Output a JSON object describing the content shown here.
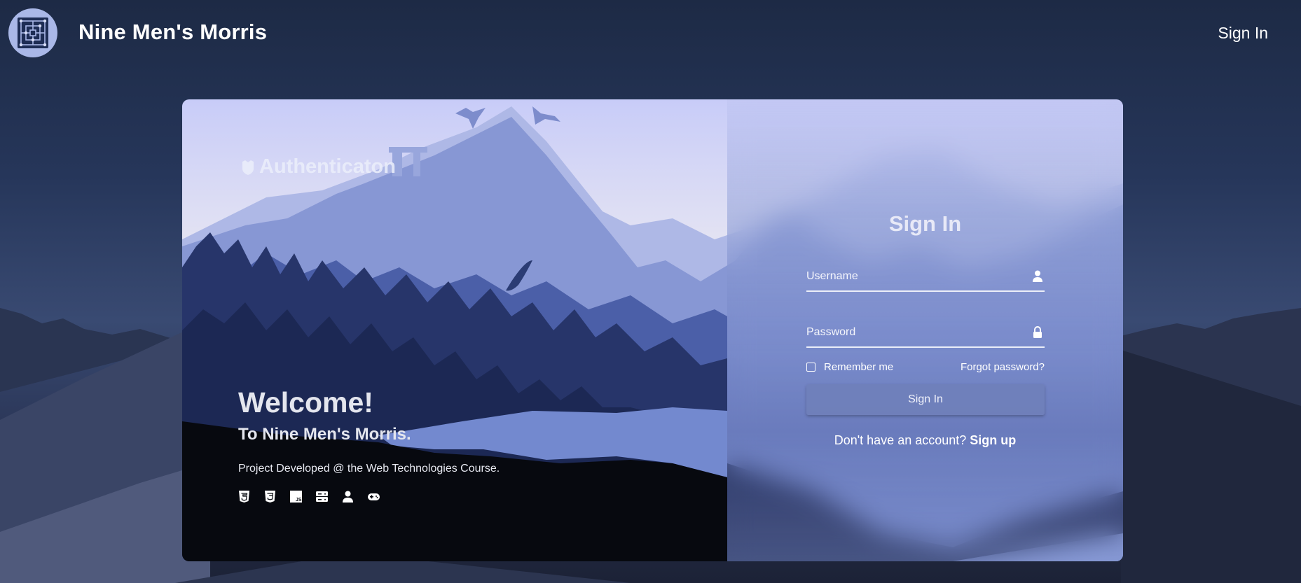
{
  "header": {
    "app_title": "Nine Men's Morris",
    "signin_link": "Sign In",
    "logo_icon": "nine-mens-morris-board-icon"
  },
  "hero": {
    "brand": "Authenticaton",
    "welcome_title": "Welcome!",
    "welcome_subtitle": "To Nine Men's Morris.",
    "project_note": "Project Developed @ the Web Technologies Course.",
    "tech_icons": [
      "html5-icon",
      "css3-icon",
      "javascript-icon",
      "server-icon",
      "user-icon",
      "gamepad-icon"
    ]
  },
  "login_form": {
    "title": "Sign In",
    "username_placeholder": "Username",
    "password_placeholder": "Password",
    "remember_label": "Remember me",
    "forgot_label": "Forgot password?",
    "submit_label": "Sign In",
    "signup_prompt": "Don't have an account?",
    "signup_link": "Sign up"
  },
  "colors": {
    "page_bg": "#26365a",
    "logo_bg": "#aab8e8",
    "button_bg": "#7080ba",
    "sky_top": "#c9cdf8"
  }
}
